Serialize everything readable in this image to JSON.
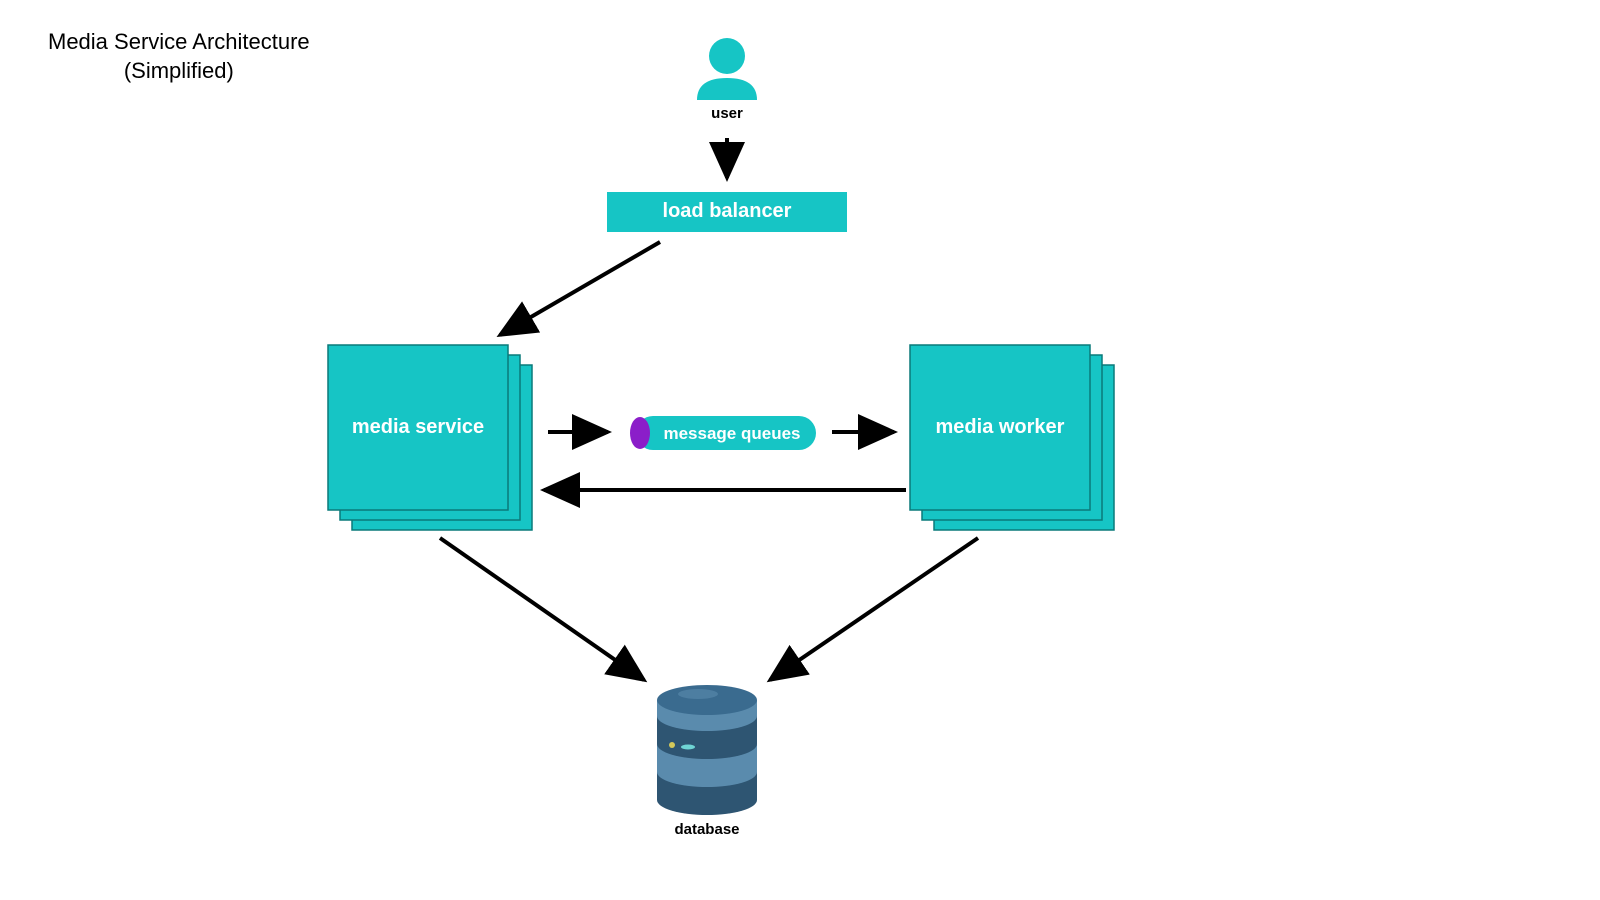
{
  "title_line1": "Media Service Architecture",
  "title_line2": "(Simplified)",
  "nodes": {
    "user": "user",
    "load_balancer": "load balancer",
    "media_service": "media service",
    "message_queues": "message queues",
    "media_worker": "media worker",
    "database": "database"
  },
  "colors": {
    "teal": "#16c5c5",
    "teal_dark": "#11b1b1",
    "purple": "#8b1ec9",
    "db_blue": "#3a6b8f",
    "db_blue_dark": "#2e5572",
    "db_blue_light": "#5a8bad"
  },
  "arrows": [
    {
      "from": "user",
      "to": "load_balancer"
    },
    {
      "from": "load_balancer",
      "to": "media_service"
    },
    {
      "from": "media_service",
      "to": "message_queues"
    },
    {
      "from": "message_queues",
      "to": "media_worker"
    },
    {
      "from": "media_worker",
      "to": "media_service"
    },
    {
      "from": "media_service",
      "to": "database"
    },
    {
      "from": "media_worker",
      "to": "database"
    }
  ]
}
